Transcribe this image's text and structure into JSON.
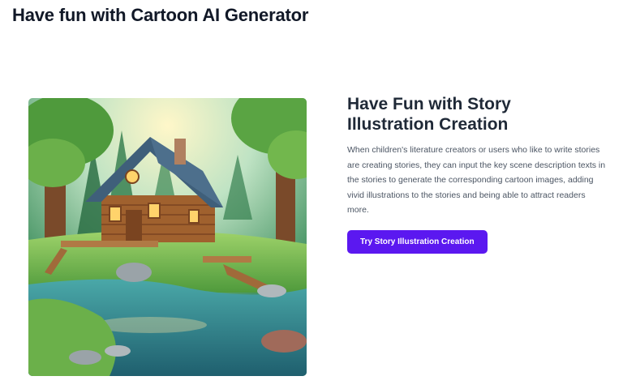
{
  "page": {
    "title": "Have fun with Cartoon AI Generator"
  },
  "feature": {
    "heading_line1": "Have Fun with Story",
    "heading_line2": "Illustration Creation",
    "description": "When children's literature creators or users who like to write stories are creating stories, they can input the key scene description texts in the stories to generate the corresponding cartoon images, adding vivid illustrations to the stories and being able to attract readers more.",
    "cta_label": "Try Story Illustration Creation"
  },
  "colors": {
    "accent": "#5b18f0",
    "heading": "#1f2937",
    "body_text": "#4b5563"
  }
}
